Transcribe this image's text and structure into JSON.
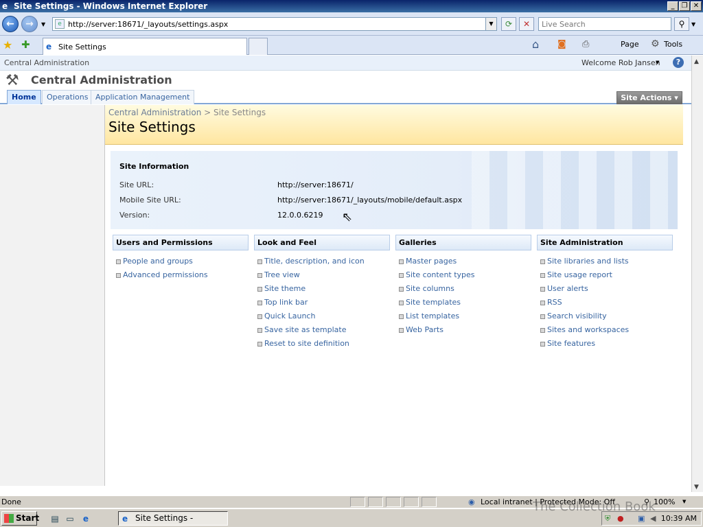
{
  "window": {
    "title": "Site Settings - Windows Internet Explorer",
    "minimize": "_",
    "maximize": "❐",
    "close": "✕"
  },
  "browser": {
    "back": "←",
    "forward": "→",
    "address": "http://server:18671/_layouts/settings.aspx",
    "search_placeholder": "Live Search",
    "tab_title": "Site Settings",
    "home_icon": "home-icon",
    "page_menu": "Page",
    "tools_menu": "Tools"
  },
  "sharepoint": {
    "global_crumb": "Central Administration",
    "welcome": "Welcome Rob Jansen",
    "site_title": "Central Administration",
    "nav_tabs": [
      {
        "label": "Home",
        "selected": true
      },
      {
        "label": "Operations",
        "selected": false
      },
      {
        "label": "Application Management",
        "selected": false
      }
    ],
    "site_actions": "Site Actions",
    "breadcrumb_root": "Central Administration",
    "breadcrumb_sep": " > ",
    "breadcrumb_current": "Site Settings",
    "page_title": "Site Settings",
    "site_info": {
      "heading": "Site Information",
      "site_url_label": "Site URL:",
      "site_url": "http://server:18671/",
      "mobile_url_label": "Mobile Site URL:",
      "mobile_url": "http://server:18671/_layouts/mobile/default.aspx",
      "version_label": "Version:",
      "version": "12.0.0.6219"
    },
    "columns": [
      {
        "heading": "Users and Permissions",
        "links": [
          "People and groups",
          "Advanced permissions"
        ]
      },
      {
        "heading": "Look and Feel",
        "links": [
          "Title, description, and icon",
          "Tree view",
          "Site theme",
          "Top link bar",
          "Quick Launch",
          "Save site as template",
          "Reset to site definition"
        ]
      },
      {
        "heading": "Galleries",
        "links": [
          "Master pages",
          "Site content types",
          "Site columns",
          "Site templates",
          "List templates",
          "Web Parts"
        ]
      },
      {
        "heading": "Site Administration",
        "links": [
          "Site libraries and lists",
          "Site usage report",
          "User alerts",
          "RSS",
          "Search visibility",
          "Sites and workspaces",
          "Site features"
        ]
      }
    ]
  },
  "statusbar": {
    "status": "Done",
    "zone": "Local intranet | Protected Mode: Off",
    "zoom": "100%"
  },
  "taskbar": {
    "start": "Start",
    "task_label": "Site Settings - Windo...",
    "clock": "10:39 AM"
  },
  "watermark": "The Collection Book"
}
